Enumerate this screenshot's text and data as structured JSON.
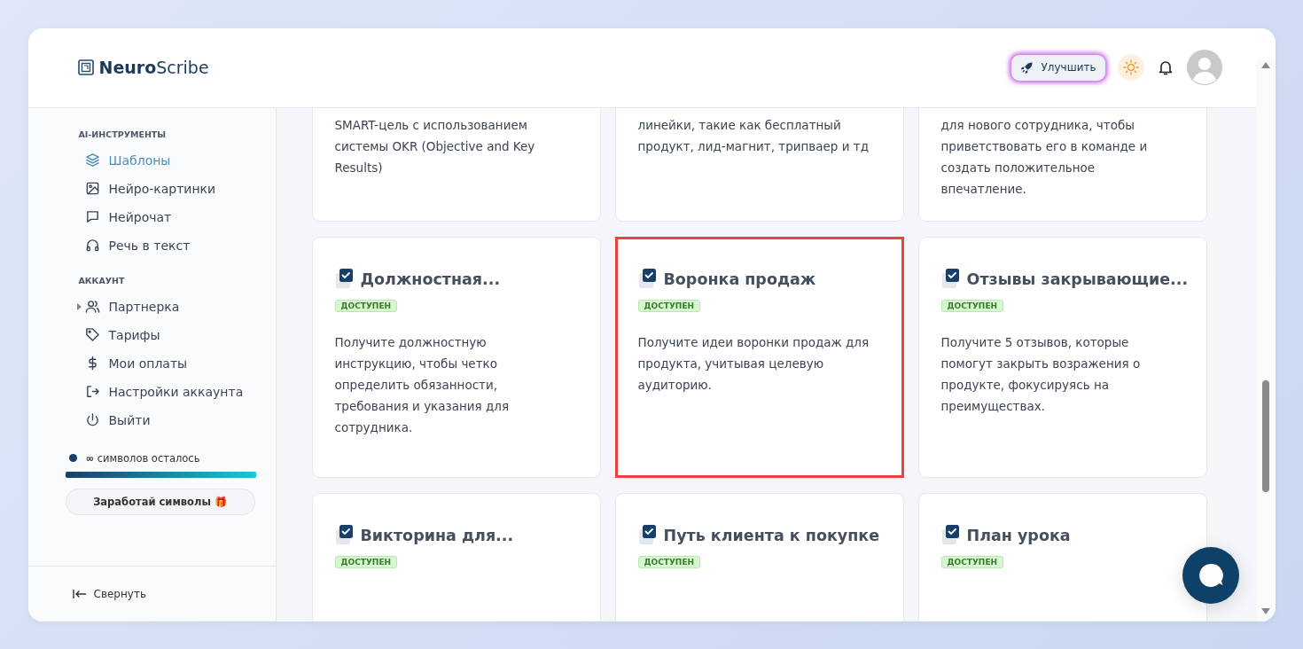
{
  "logo": {
    "bold": "Neuro",
    "light": "Scribe"
  },
  "header": {
    "upgrade_button": "Улучшить"
  },
  "sidebar": {
    "sections": [
      {
        "title": "AI-ИНСТРУМЕНТЫ",
        "items": [
          {
            "label": "Шаблоны",
            "kind": "layers",
            "selected": true,
            "expandable": false
          },
          {
            "label": "Нейро-картинки",
            "kind": "image",
            "selected": false,
            "expandable": false
          },
          {
            "label": "Нейрочат",
            "kind": "chat",
            "selected": false,
            "expandable": false
          },
          {
            "label": "Речь в текст",
            "kind": "headphones",
            "selected": false,
            "expandable": false
          }
        ]
      },
      {
        "title": "АККАУНТ",
        "items": [
          {
            "label": "Партнерка",
            "kind": "users",
            "selected": false,
            "expandable": true
          },
          {
            "label": "Тарифы",
            "kind": "tag",
            "selected": false,
            "expandable": false
          },
          {
            "label": "Мои оплаты",
            "kind": "dollar",
            "selected": false,
            "expandable": false
          },
          {
            "label": "Настройки аккаунта",
            "kind": "logout",
            "selected": false,
            "expandable": false
          },
          {
            "label": "Выйти",
            "kind": "power",
            "selected": false,
            "expandable": false
          }
        ]
      }
    ],
    "credits": {
      "amount": "∞",
      "label": "символов осталось",
      "level": 1
    },
    "earn_button": "Заработай символы 🎁",
    "collapse": "Свернуть"
  },
  "cards_top": [
    {
      "description": "SMART-цель с использованием системы OKR (Objective and Key Results)"
    },
    {
      "description": "линейки, такие как бесплатный продукт, лид-магнит, трипваер и тд"
    },
    {
      "description": "для нового сотрудника, чтобы приветствовать его в команде и создать положительное впечатление."
    }
  ],
  "cards": [
    {
      "title": "Должностная...",
      "badge": "ДОСТУПЕН",
      "description": "Получите должностную инструкцию, чтобы четко определить обязанности, требования и указания для сотрудника.",
      "highlighted": false
    },
    {
      "title": "Воронка продаж",
      "badge": "ДОСТУПЕН",
      "description": "Получите идеи воронки продаж для продукта, учитывая целевую аудиторию.",
      "highlighted": true
    },
    {
      "title": "Отзывы закрывающие...",
      "badge": "ДОСТУПЕН",
      "description": "Получите 5 отзывов, которые помогут закрыть возражения о продукте, фокусируясь на преимуществах.",
      "highlighted": false
    },
    {
      "title": "Викторина для...",
      "badge": "ДОСТУПЕН",
      "highlighted": false
    },
    {
      "title": "Путь клиента к покупке",
      "badge": "ДОСТУПЕН",
      "highlighted": false
    },
    {
      "title": "План урока",
      "badge": "ДОСТУПЕН",
      "highlighted": false
    }
  ]
}
